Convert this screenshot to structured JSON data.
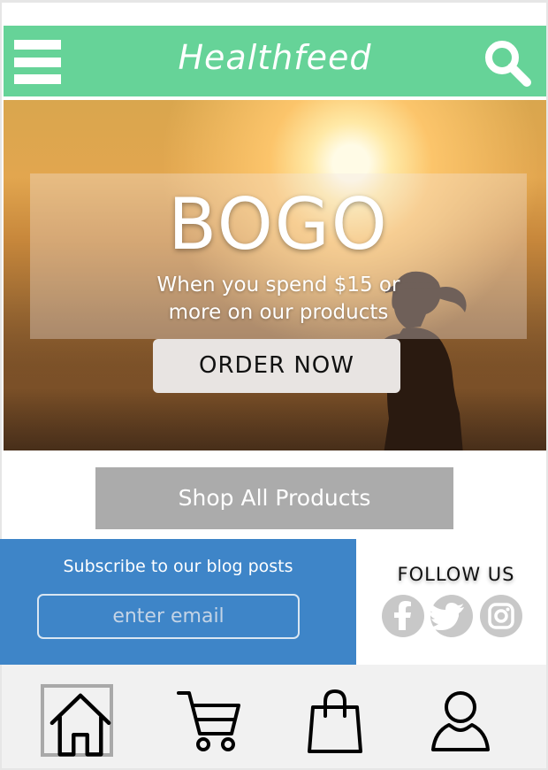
{
  "header": {
    "brand": "Healthfeed",
    "menu_icon": "hamburger-menu-icon",
    "search_icon": "search-icon",
    "background_color": "#66d398"
  },
  "hero": {
    "headline": "BOGO",
    "promo_line_1": "When you spend $15 or",
    "promo_line_2": "more on our products",
    "cta_label": "ORDER NOW",
    "image": "runner-sunset-silhouette"
  },
  "shop": {
    "button_label": "Shop All Products",
    "button_color": "#ababab"
  },
  "subscribe": {
    "label": "Subscribe to our blog posts",
    "email_placeholder": "enter email",
    "background_color": "#3e85c8"
  },
  "follow": {
    "label": "FOLLOW US",
    "icons": [
      "facebook-icon",
      "twitter-icon",
      "instagram-icon"
    ]
  },
  "bottom_nav": {
    "items": [
      "home-icon",
      "cart-icon",
      "shopping-bag-icon",
      "user-icon"
    ],
    "active": "home-icon"
  }
}
